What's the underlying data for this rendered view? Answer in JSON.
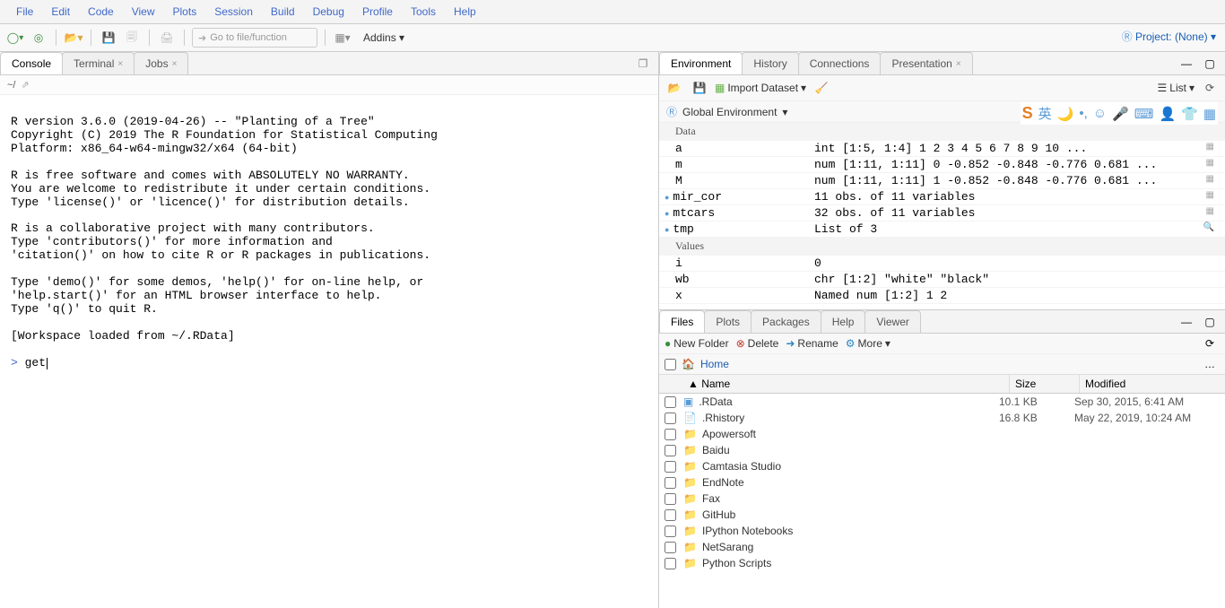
{
  "menu": [
    "File",
    "Edit",
    "Code",
    "View",
    "Plots",
    "Session",
    "Build",
    "Debug",
    "Profile",
    "Tools",
    "Help"
  ],
  "toolbar": {
    "goto": "Go to file/function",
    "addins": "Addins"
  },
  "project": "Project: (None)",
  "left_tabs": {
    "console": "Console",
    "terminal": "Terminal",
    "jobs": "Jobs"
  },
  "console_path": "~/",
  "console_lines": [
    "",
    "R version 3.6.0 (2019-04-26) -- \"Planting of a Tree\"",
    "Copyright (C) 2019 The R Foundation for Statistical Computing",
    "Platform: x86_64-w64-mingw32/x64 (64-bit)",
    "",
    "R is free software and comes with ABSOLUTELY NO WARRANTY.",
    "You are welcome to redistribute it under certain conditions.",
    "Type 'license()' or 'licence()' for distribution details.",
    "",
    "R is a collaborative project with many contributors.",
    "Type 'contributors()' for more information and",
    "'citation()' on how to cite R or R packages in publications.",
    "",
    "Type 'demo()' for some demos, 'help()' for on-line help, or",
    "'help.start()' for an HTML browser interface to help.",
    "Type 'q()' to quit R.",
    "",
    "[Workspace loaded from ~/.RData]",
    ""
  ],
  "console_prompt": ">",
  "console_input": "get",
  "env_tabs": {
    "env": "Environment",
    "history": "History",
    "conn": "Connections",
    "pres": "Presentation"
  },
  "env_toolbar": {
    "import": "Import Dataset",
    "list": "List"
  },
  "env_scope": "Global Environment",
  "env_sections": {
    "data": "Data",
    "values": "Values"
  },
  "env_data": [
    {
      "name": "a",
      "value": "int [1:5, 1:4] 1 2 3 4 5 6 7 8 9 10 ...",
      "obj": false,
      "grid": true
    },
    {
      "name": "m",
      "value": "num [1:11, 1:11] 0 -0.852 -0.848 -0.776 0.681 ...",
      "obj": false,
      "grid": true
    },
    {
      "name": "M",
      "value": "num [1:11, 1:11] 1 -0.852 -0.848 -0.776 0.681 ...",
      "obj": false,
      "grid": true
    },
    {
      "name": "mir_cor",
      "value": "11 obs. of 11 variables",
      "obj": true,
      "grid": true
    },
    {
      "name": "mtcars",
      "value": "32 obs. of 11 variables",
      "obj": true,
      "grid": true
    },
    {
      "name": "tmp",
      "value": "List of 3",
      "obj": true,
      "search": true
    }
  ],
  "env_values": [
    {
      "name": "i",
      "value": "0"
    },
    {
      "name": "wb",
      "value": "chr [1:2] \"white\" \"black\""
    },
    {
      "name": "x",
      "value": "Named num [1:2] 1 2"
    }
  ],
  "files_tabs": {
    "files": "Files",
    "plots": "Plots",
    "packages": "Packages",
    "help": "Help",
    "viewer": "Viewer"
  },
  "files_toolbar": {
    "newfolder": "New Folder",
    "delete": "Delete",
    "rename": "Rename",
    "more": "More"
  },
  "files_crumb": "Home",
  "files_headers": {
    "name": "Name",
    "size": "Size",
    "mod": "Modified"
  },
  "files": [
    {
      "icon": "rdata",
      "name": ".RData",
      "size": "10.1 KB",
      "mod": "Sep 30, 2015, 6:41 AM"
    },
    {
      "icon": "rhistory",
      "name": ".Rhistory",
      "size": "16.8 KB",
      "mod": "May 22, 2019, 10:24 AM"
    },
    {
      "icon": "folder",
      "name": "Apowersoft",
      "size": "",
      "mod": ""
    },
    {
      "icon": "folder",
      "name": "Baidu",
      "size": "",
      "mod": ""
    },
    {
      "icon": "folder",
      "name": "Camtasia Studio",
      "size": "",
      "mod": ""
    },
    {
      "icon": "folder",
      "name": "EndNote",
      "size": "",
      "mod": ""
    },
    {
      "icon": "folder",
      "name": "Fax",
      "size": "",
      "mod": ""
    },
    {
      "icon": "folder",
      "name": "GitHub",
      "size": "",
      "mod": ""
    },
    {
      "icon": "folder",
      "name": "IPython Notebooks",
      "size": "",
      "mod": ""
    },
    {
      "icon": "folder",
      "name": "NetSarang",
      "size": "",
      "mod": ""
    },
    {
      "icon": "folder",
      "name": "Python Scripts",
      "size": "",
      "mod": ""
    }
  ]
}
